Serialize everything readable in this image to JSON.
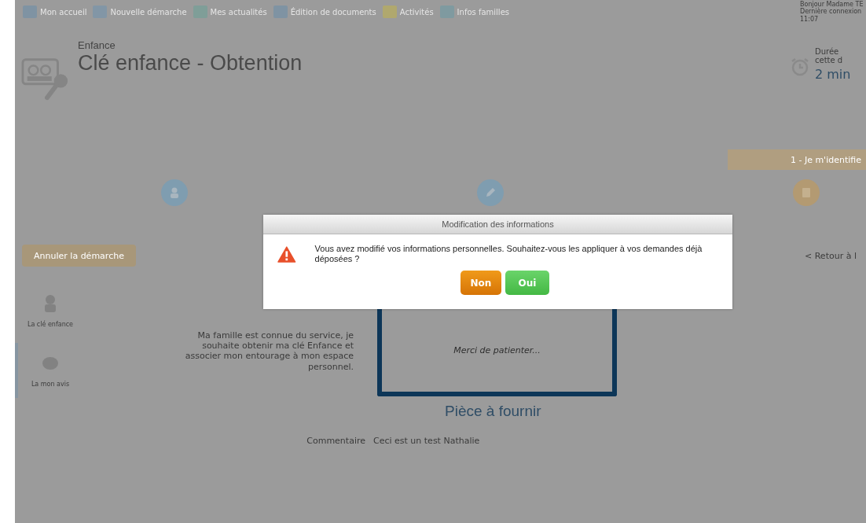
{
  "nav": [
    {
      "label": "Mon accueil",
      "color": "#7f93a3"
    },
    {
      "label": "Nouvelle démarche",
      "color": "#8296a6"
    },
    {
      "label": "Mes actualités",
      "color": "#7f9e98"
    },
    {
      "label": "Édition de documents",
      "color": "#7f93a3"
    },
    {
      "label": "Activités",
      "color": "#b0a86e"
    },
    {
      "label": "Infos familles",
      "color": "#7f9aa0"
    }
  ],
  "user": {
    "greeting": "Bonjour Madame TE",
    "last_login": "Dernière connexion",
    "time": "11:07"
  },
  "header": {
    "category": "Enfance",
    "title": "Clé enfance - Obtention"
  },
  "duration": {
    "label_1": "Durée",
    "label_2": "cette d",
    "value": "2 min"
  },
  "step_bar": {
    "label": "1 - Je m'identifie"
  },
  "steps": [
    {
      "kind": "person",
      "color": "#7f9db0"
    },
    {
      "kind": "pencil",
      "color": "#7f9db0"
    },
    {
      "kind": "list",
      "color": "#b39a72"
    }
  ],
  "cancel_button": "Annuler la démarche",
  "back_link": "< Retour à l",
  "sidebar": [
    {
      "label": "La clé enfance",
      "kind": "person",
      "selected": false
    },
    {
      "label": "La mon avis",
      "kind": "chat",
      "selected": true
    }
  ],
  "description": "Ma famille est connue du service, je souhaite obtenir ma clé Enfance et associer mon entourage à mon espace personnel.",
  "loading": {
    "message": "Merci de patienter..."
  },
  "section_title": "Pièce à fournir",
  "comment": {
    "label": "Commentaire",
    "value": "Ceci est un test Nathalie"
  },
  "dialog": {
    "title": "Modification des informations",
    "message": "Vous avez modifié vos informations personnelles. Souhaitez-vous les appliquer à vos demandes déjà déposées ?",
    "buttons": [
      {
        "label": "Non",
        "kind": "no"
      },
      {
        "label": "Oui",
        "kind": "yes"
      }
    ]
  }
}
